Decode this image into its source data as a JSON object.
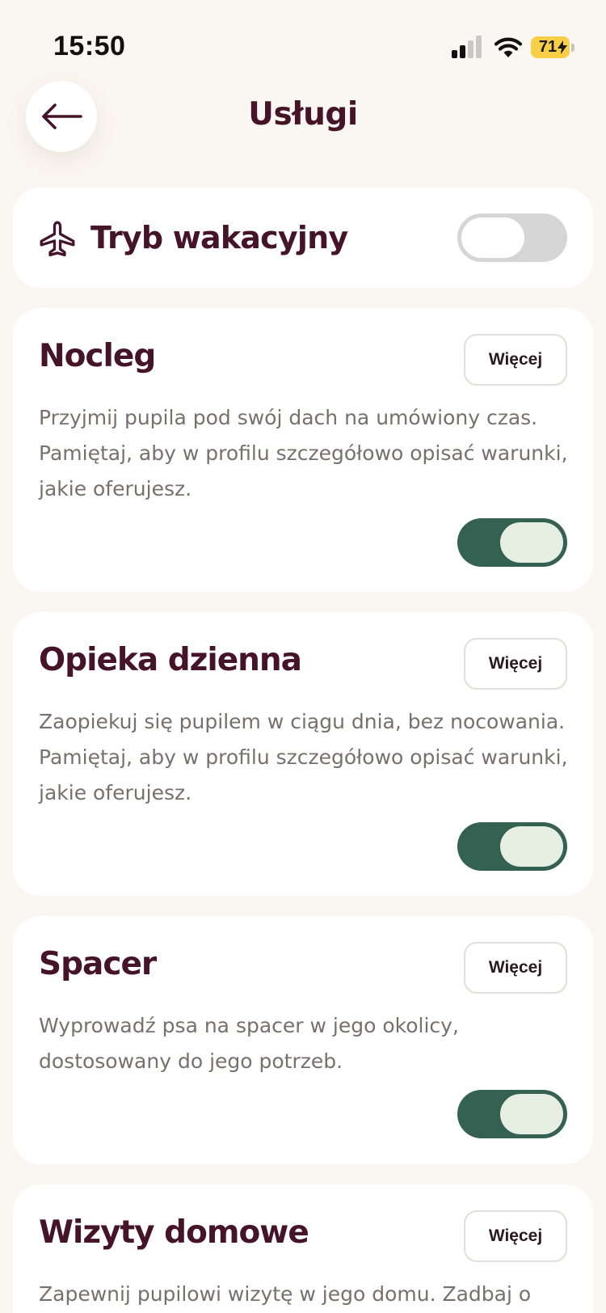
{
  "status_bar": {
    "time": "15:50",
    "battery": "71",
    "icons": [
      "signal-icon",
      "wifi-icon",
      "battery-icon",
      "charging-bolt-icon"
    ]
  },
  "header": {
    "title": "Usługi",
    "back_icon": "arrow-left-icon"
  },
  "vacation_mode": {
    "label": "Tryb wakacyjny",
    "icon": "airplane-icon",
    "enabled": false
  },
  "services": [
    {
      "title": "Nocleg",
      "more_label": "Więcej",
      "description": "Przyjmij pupila pod swój dach na umówiony czas. Pamiętaj, aby w profilu szczegółowo opisać warunki, jakie oferujesz.",
      "enabled": true
    },
    {
      "title": "Opieka dzienna",
      "more_label": "Więcej",
      "description": "Zaopiekuj się pupilem w ciągu dnia, bez nocowania. Pamiętaj, aby w profilu szczegółowo opisać warunki, jakie oferujesz.",
      "enabled": true
    },
    {
      "title": "Spacer",
      "more_label": "Więcej",
      "description": "Wyprowadź psa na spacer w jego okolicy, dostosowany do jego potrzeb.",
      "enabled": true
    },
    {
      "title": "Wizyty domowe",
      "more_label": "Więcej",
      "description": "Zapewnij pupilowi wizytę w jego domu. Zadbaj o",
      "enabled": null
    }
  ],
  "colors": {
    "background": "#faf6f1",
    "card": "#ffffff",
    "title": "#451428",
    "body_text": "#77706d",
    "toggle_on_track": "#346152",
    "toggle_on_knob": "#e7efe3",
    "toggle_off_track": "#d6d6d7",
    "battery": "#f8cf47"
  }
}
